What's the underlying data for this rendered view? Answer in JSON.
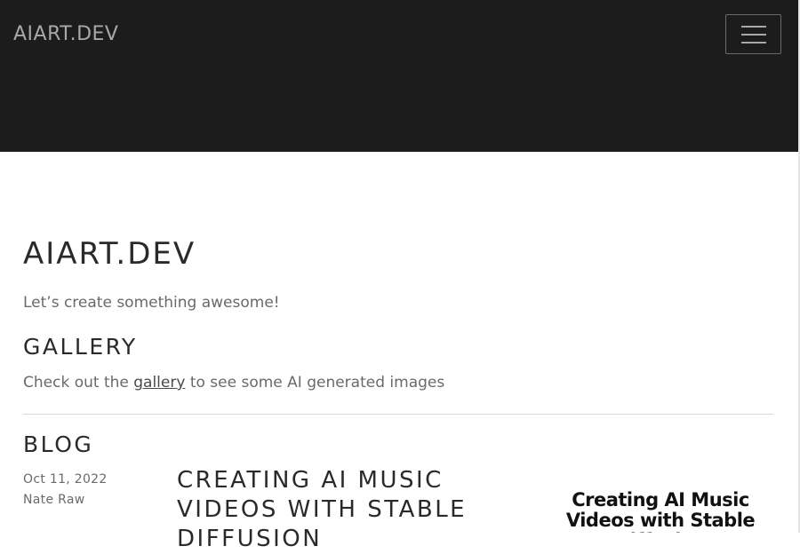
{
  "navbar": {
    "brand": "AIART.DEV",
    "toggle_icon": "hamburger-menu-icon"
  },
  "hero": {
    "title": "AIART.DEV",
    "tagline": "Let’s create something awesome!"
  },
  "gallery": {
    "heading": "GALLERY",
    "text_before": "Check out the ",
    "link_label": "gallery",
    "text_after": " to see some AI generated images"
  },
  "blog": {
    "heading": "BLOG",
    "posts": [
      {
        "date": "Oct 11, 2022",
        "author": "Nate Raw",
        "title": "CREATING AI MUSIC VIDEOS WITH STABLE DIFFUSION",
        "thumbnail_text": "Creating AI Music Videos with Stable Diffusion"
      }
    ]
  },
  "colors": {
    "navbar_bg": "#1c1c1c",
    "brand_text": "#a8a8a8",
    "heading_text": "#2a2a2a",
    "body_text": "#6a6a6a"
  }
}
